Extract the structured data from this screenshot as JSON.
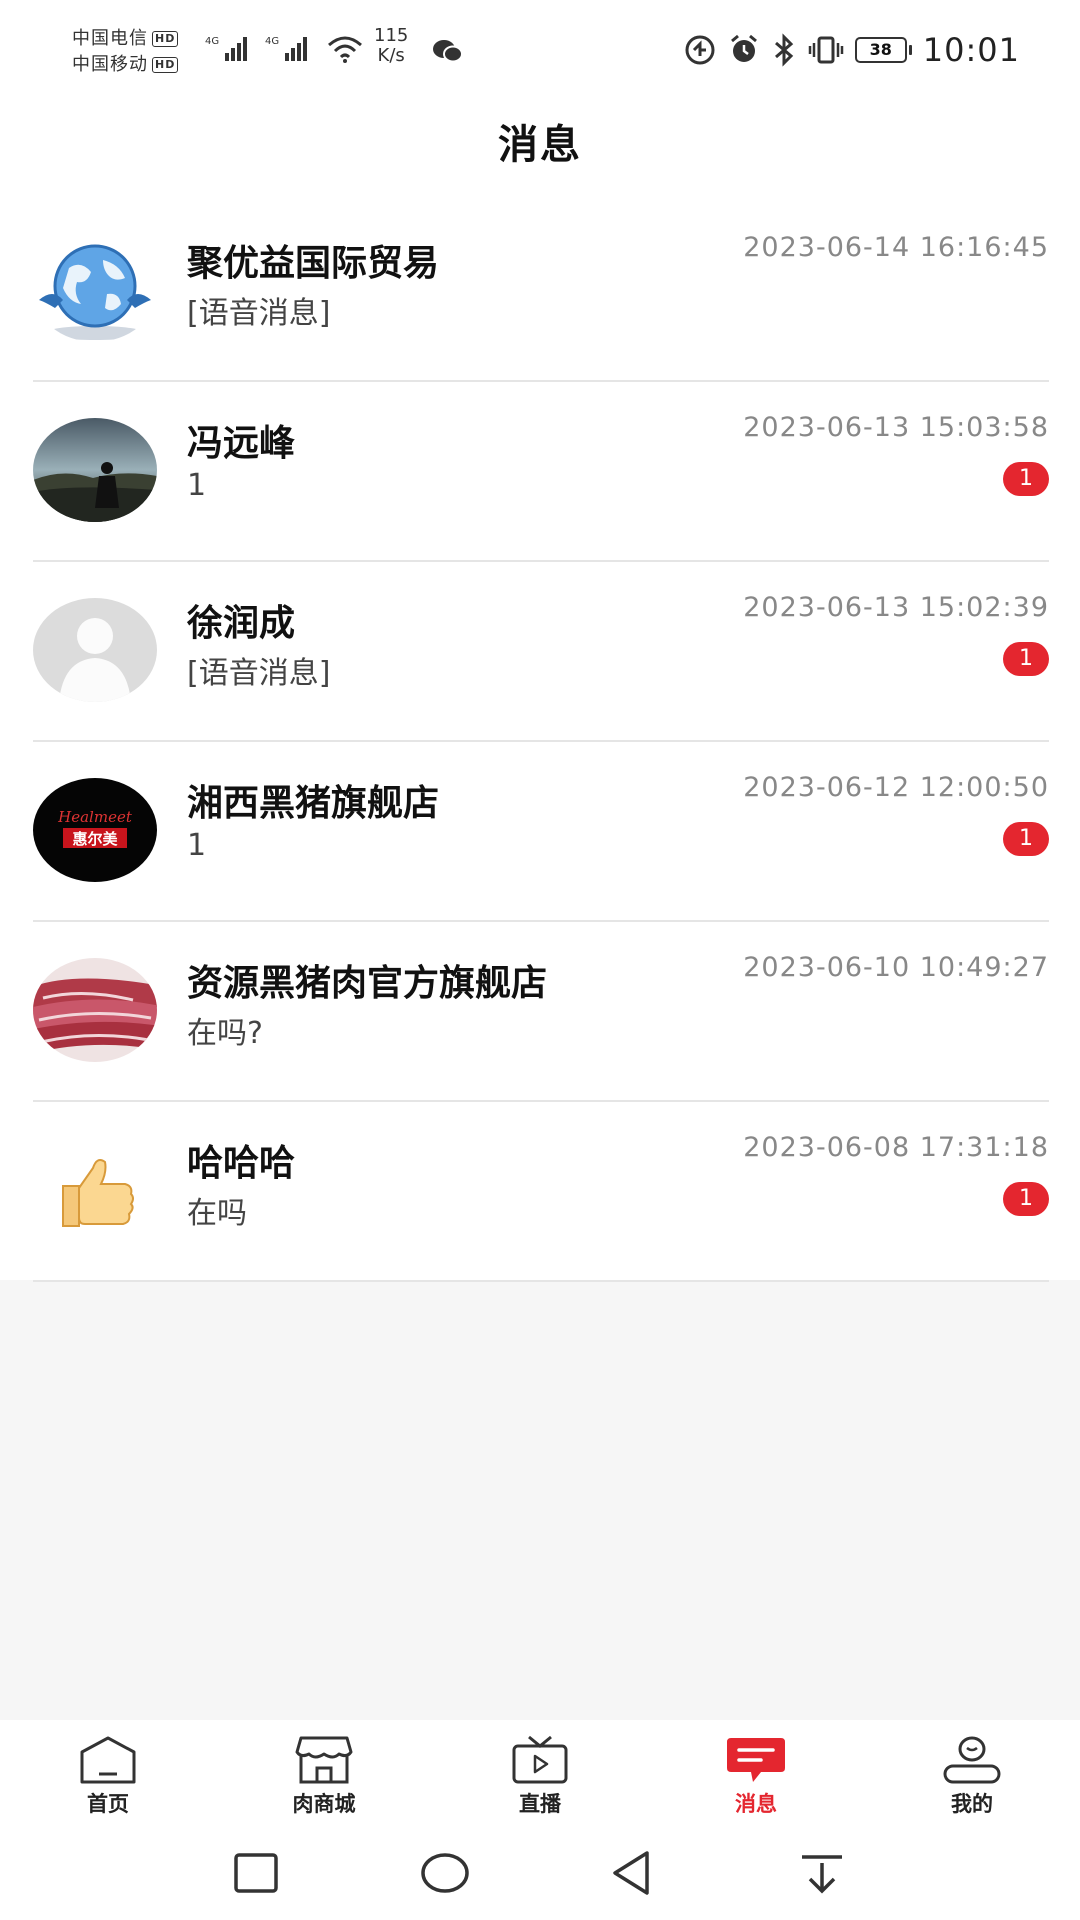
{
  "status_bar": {
    "carrier1": "中国电信",
    "carrier2": "中国移动",
    "hd_label": "HD",
    "net_type": "4G",
    "speed_value": "115",
    "speed_unit": "K/s",
    "battery": "38",
    "time": "10:01"
  },
  "header": {
    "title": "消息"
  },
  "conversations": [
    {
      "name": "聚优益国际贸易",
      "preview": "[语音消息]",
      "time": "2023-06-14 16:16:45",
      "badge": ""
    },
    {
      "name": "冯远峰",
      "preview": "1",
      "time": "2023-06-13 15:03:58",
      "badge": "1"
    },
    {
      "name": "徐润成",
      "preview": "[语音消息]",
      "time": "2023-06-13 15:02:39",
      "badge": "1"
    },
    {
      "name": "湘西黑猪旗舰店",
      "preview": "1",
      "time": "2023-06-12 12:00:50",
      "badge": "1"
    },
    {
      "name": "资源黑猪肉官方旗舰店",
      "preview": "在吗?",
      "time": "2023-06-10 10:49:27",
      "badge": ""
    },
    {
      "name": "哈哈哈",
      "preview": "在吗",
      "time": "2023-06-08 17:31:18",
      "badge": "1"
    }
  ],
  "avatar_logo_text": {
    "script": "Healmeet",
    "cn": "惠尔美"
  },
  "tabs": [
    {
      "label": "首页",
      "icon": "home-icon"
    },
    {
      "label": "肉商城",
      "icon": "store-icon"
    },
    {
      "label": "直播",
      "icon": "tv-play-icon"
    },
    {
      "label": "消息",
      "icon": "message-icon",
      "active": true
    },
    {
      "label": "我的",
      "icon": "profile-icon"
    }
  ],
  "colors": {
    "accent": "#e4262f",
    "badge": "#e4262f",
    "divider": "#e5e5e5",
    "background": "#f6f6f6"
  }
}
